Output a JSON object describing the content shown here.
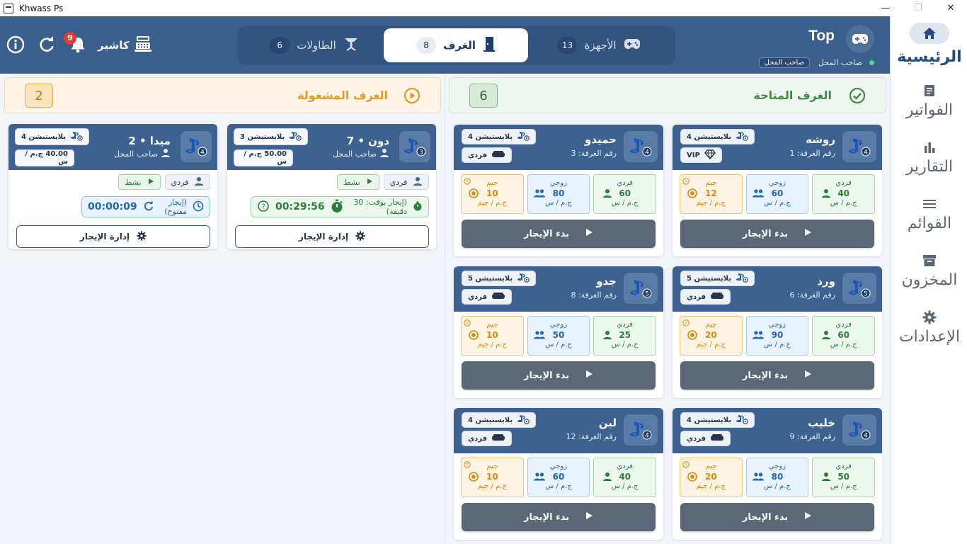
{
  "window": {
    "title": "Khwass Ps",
    "min": "—",
    "max": "❐",
    "close": "✕"
  },
  "sidebar": {
    "items": [
      {
        "label": "الرئيسية",
        "icon": "home-icon",
        "active": true
      },
      {
        "label": "الفواتير",
        "icon": "receipt-icon"
      },
      {
        "label": "التقارير",
        "icon": "bar-chart-icon"
      },
      {
        "label": "القوائم",
        "icon": "list-icon"
      },
      {
        "label": "المخزون",
        "icon": "archive-icon"
      },
      {
        "label": "الإعدادات",
        "icon": "gear-icon"
      }
    ]
  },
  "header": {
    "cashier_label": "كاشير",
    "notification_count": "9",
    "brand_name": "Top",
    "owner_status": "صاحب المحل",
    "owner_role": "صاحب المحل",
    "tabs": [
      {
        "label": "الأجهزة",
        "count": "13"
      },
      {
        "label": "الغرف",
        "count": "8",
        "active": true
      },
      {
        "label": "الطاولات",
        "count": "6"
      }
    ]
  },
  "available": {
    "title": "الغرف المتاحة",
    "count": "6",
    "price_labels": {
      "single": "فردي",
      "double": "زوجي",
      "gym": "جيم"
    },
    "price_unit": "ج.م / س",
    "gym_unit": "ج.م / جيم",
    "start_label": "بدء الإيجار",
    "rooms": [
      {
        "name": "روشه",
        "room_no": "رقم الغرفة: 1",
        "device": "بلايستيشن 4",
        "badge": "4",
        "mode": "VIP",
        "single": "40",
        "double": "60",
        "gym": "12"
      },
      {
        "name": "حميدو",
        "room_no": "رقم الغرفة: 3",
        "device": "بلايستيشن 4",
        "badge": "4",
        "mode": "فردي",
        "single": "60",
        "double": "80",
        "gym": "10"
      },
      {
        "name": "ورد",
        "room_no": "رقم الغرفة: 6",
        "device": "بلايستيشن 5",
        "badge": "5",
        "mode": "فردي",
        "single": "60",
        "double": "90",
        "gym": "20"
      },
      {
        "name": "جدو",
        "room_no": "رقم الغرفة: 8",
        "device": "بلايستيشن 5",
        "badge": "5",
        "mode": "فردي",
        "single": "25",
        "double": "50",
        "gym": "10"
      },
      {
        "name": "خليب",
        "room_no": "رقم الغرفة: 9",
        "device": "بلايستيشن 4",
        "badge": "4",
        "mode": "فردي",
        "single": "50",
        "double": "80",
        "gym": "20"
      },
      {
        "name": "لبن",
        "room_no": "رقم الغرفة: 12",
        "device": "بلايستيشن 4",
        "badge": "4",
        "mode": "فردي",
        "single": "40",
        "double": "60",
        "gym": "10"
      }
    ]
  },
  "occupied": {
    "title": "الغرف المشغولة",
    "count": "2",
    "manage_label": "إدارة الإيجار",
    "rooms": [
      {
        "name": "دون • 7",
        "owner": "صاحب المحل",
        "device": "بلايستيشن 3",
        "badge": "3",
        "rate": "50.00 ج.م / س",
        "type": "فردي",
        "status": "نشط",
        "timer_label": "(إيجار بوقت: 30 دقيقة)",
        "timer": "00:29:56"
      },
      {
        "name": "ميدا • 2",
        "owner": "صاحب المحل",
        "device": "بلايستيشن 4",
        "badge": "4",
        "rate": "40.00 ج.م / س",
        "type": "فردي",
        "status": "نشط",
        "timer_label": "(إيجار مفتوح)",
        "timer": "00:00:09"
      }
    ]
  },
  "colors": {
    "header": "#3a5f8e",
    "available": "#3d8b45",
    "occupied": "#e49a1d",
    "start_button": "#5b6677"
  }
}
